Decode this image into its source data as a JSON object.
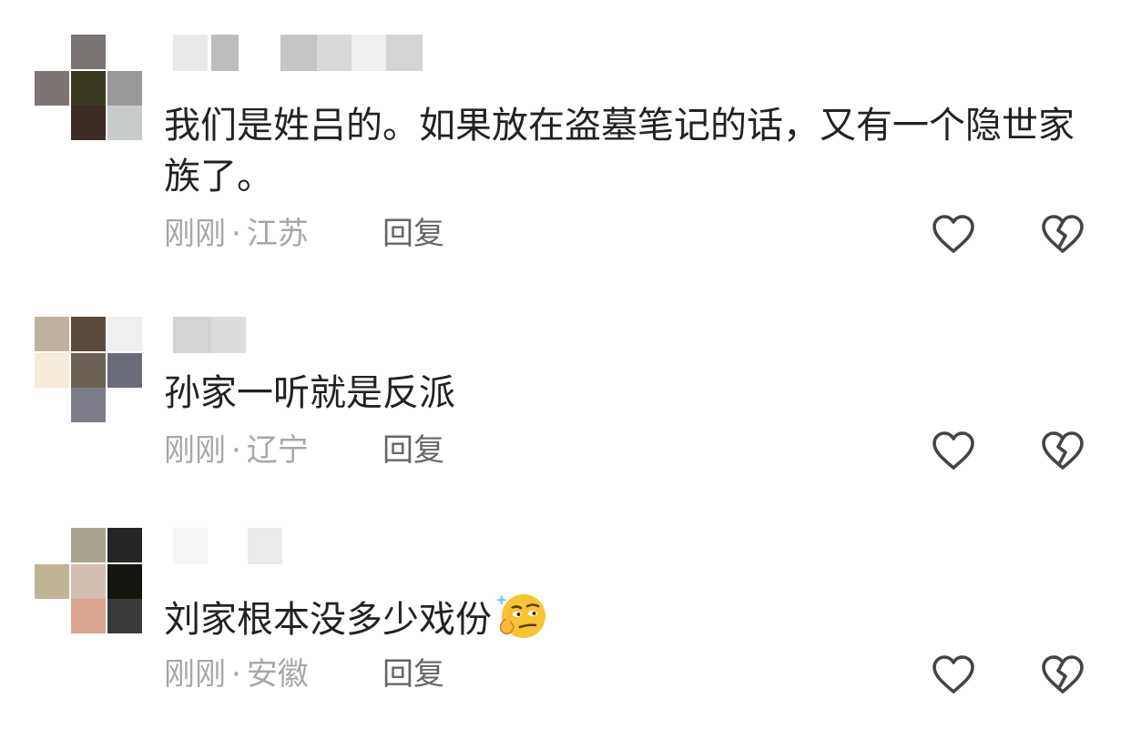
{
  "comments": [
    {
      "text": "我们是姓吕的。如果放在盗墓笔记的话，又有一个隐世家族了。",
      "time": "刚刚",
      "location": "江苏",
      "reply_label": "回复"
    },
    {
      "text": "孙家一听就是反派",
      "time": "刚刚",
      "location": "辽宁",
      "reply_label": "回复"
    },
    {
      "text": "刘家根本没多少戏份",
      "time": "刚刚",
      "location": "安徽",
      "reply_label": "回复",
      "emoji": "thinking-smirk-emoji"
    }
  ],
  "meta_separator": "·",
  "icons": {
    "like": "heart-outline-icon",
    "dislike": "broken-heart-icon"
  },
  "colors": {
    "text": "#222222",
    "meta": "#a7a7a7",
    "reply": "#666666",
    "icon": "#444444"
  }
}
